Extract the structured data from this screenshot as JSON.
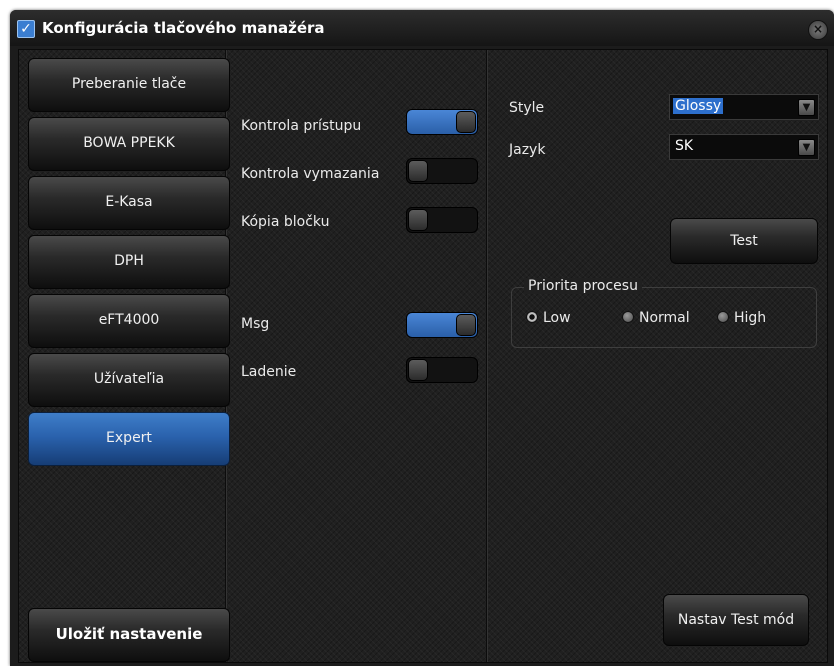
{
  "window": {
    "title": "Konfigurácia tlačového manažéra"
  },
  "sidebar": {
    "items": [
      {
        "label": "Preberanie tlače",
        "active": false
      },
      {
        "label": "BOWA PPEKK",
        "active": false
      },
      {
        "label": "E-Kasa",
        "active": false
      },
      {
        "label": "DPH",
        "active": false
      },
      {
        "label": "eFT4000",
        "active": false
      },
      {
        "label": "Užívateľia",
        "active": false
      },
      {
        "label": "Expert",
        "active": true
      }
    ],
    "save_label": "Uložiť nastavenie"
  },
  "toggles": [
    {
      "label": "Kontrola prístupu",
      "on": true
    },
    {
      "label": "Kontrola vymazania",
      "on": false
    },
    {
      "label": "Kópia bločku",
      "on": false
    },
    {
      "label": "Msg",
      "on": true
    },
    {
      "label": "Ladenie",
      "on": false
    }
  ],
  "settings": {
    "style_label": "Style",
    "style_value": "Glossy",
    "language_label": "Jazyk",
    "language_value": "SK",
    "test_label": "Test",
    "test_mode_label": "Nastav Test mód"
  },
  "priority": {
    "title": "Priorita procesu",
    "options": [
      {
        "label": "Low",
        "checked": true
      },
      {
        "label": "Normal",
        "checked": false
      },
      {
        "label": "High",
        "checked": false
      }
    ]
  },
  "colors": {
    "accent": "#2d6fcc",
    "background": "#202020"
  }
}
